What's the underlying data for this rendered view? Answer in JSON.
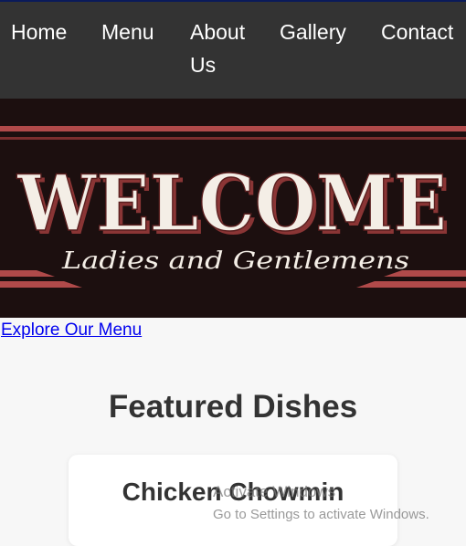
{
  "nav": {
    "items": [
      {
        "label": "Home"
      },
      {
        "label": "Menu"
      },
      {
        "label": "About Us"
      },
      {
        "label": "Gallery"
      },
      {
        "label": "Contact"
      }
    ]
  },
  "hero": {
    "title": "WELCOME",
    "subtitle": "Ladies and Gentlemens"
  },
  "cta": {
    "label": "Explore Our Menu"
  },
  "featured": {
    "heading": "Featured Dishes",
    "dishes": [
      {
        "name": "Chicken Chowmin"
      }
    ]
  },
  "watermark": {
    "title": "Activate Windows",
    "subtitle": "Go to Settings to activate Windows."
  },
  "colors": {
    "nav_background": "#333333",
    "hero_background": "#1c0f0f",
    "hero_accent": "#b04a4a",
    "link": "#0000ee"
  }
}
